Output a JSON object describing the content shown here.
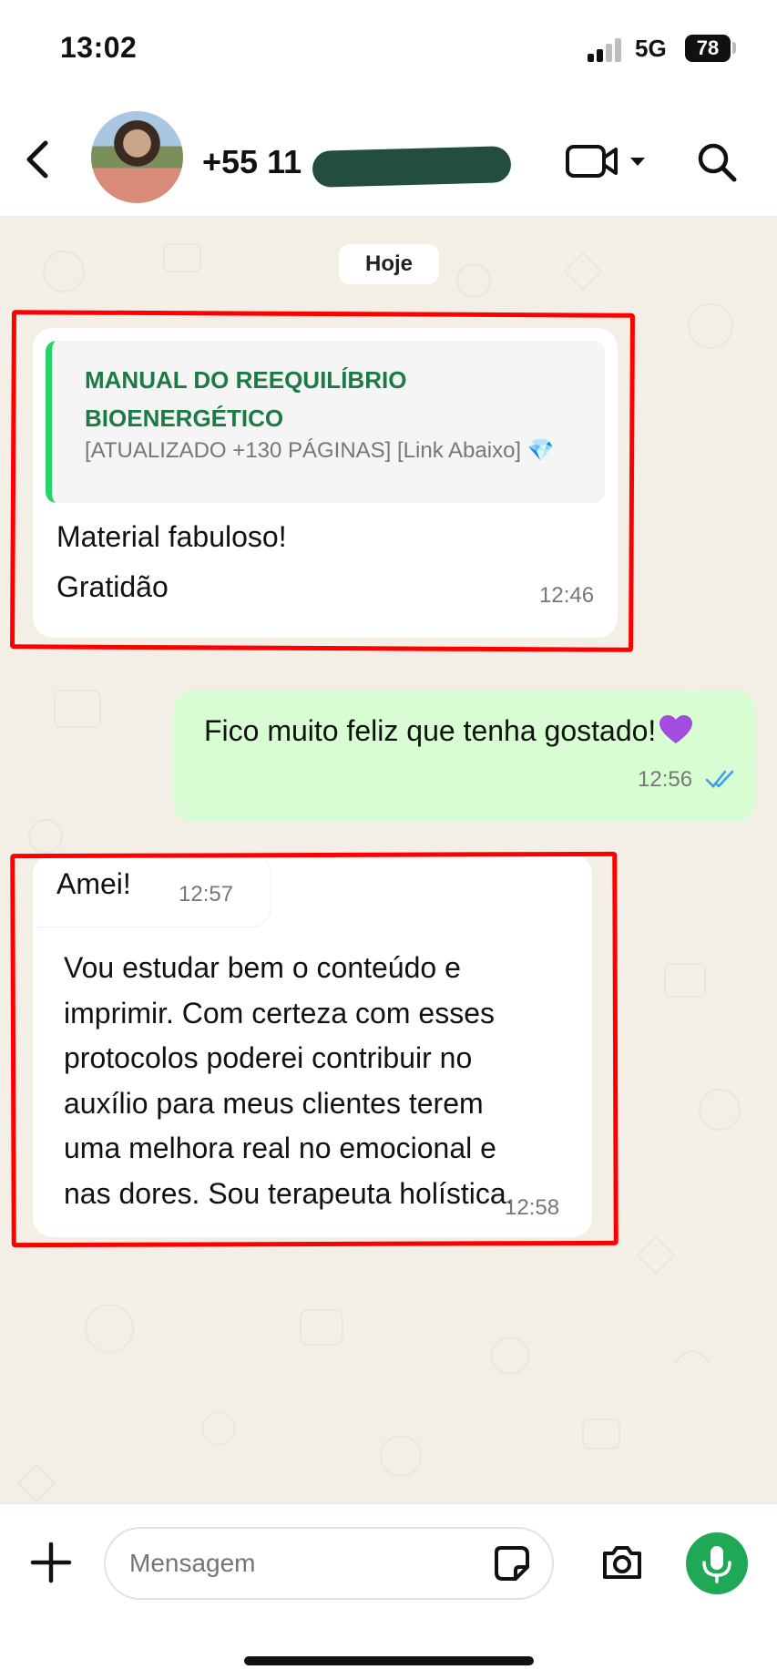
{
  "status_bar": {
    "time": "13:02",
    "network": "5G",
    "battery": "78"
  },
  "header": {
    "contact_name": "+55 11",
    "back_icon": "chevron-left-icon",
    "video_icon": "video-camera-icon",
    "dropdown_icon": "caret-down-icon",
    "search_icon": "search-icon"
  },
  "chat": {
    "date_label": "Hoje",
    "messages": [
      {
        "direction": "in",
        "quote_title": "MANUAL DO REEQUILÍBRIO BIOENERGÉTICO",
        "quote_subtitle": "[ATUALIZADO +130 PÁGINAS] [Link Abaixo]",
        "quote_emoji": "💎",
        "line1": "Material fabuloso!",
        "line2": "Gratidão",
        "time": "12:46"
      },
      {
        "direction": "out",
        "text": "Fico muito feliz que tenha gostado!",
        "emoji": "purple-heart",
        "time": "12:56",
        "status": "read"
      },
      {
        "direction": "in",
        "text": "Amei!",
        "time": "12:57"
      },
      {
        "direction": "in",
        "lines": [
          "Vou estudar bem o conteúdo e",
          "imprimir. Com certeza com esses",
          "protocolos poderei contribuir no",
          "auxílio para meus clientes terem",
          "uma melhora real no emocional e",
          "nas dores. Sou terapeuta holística."
        ],
        "time": "12:58"
      }
    ]
  },
  "input_bar": {
    "placeholder": "Mensagem",
    "plus_icon": "plus-icon",
    "sticker_icon": "sticker-icon",
    "camera_icon": "camera-icon",
    "mic_icon": "microphone-icon"
  },
  "colors": {
    "accent_green": "#1fa855",
    "outgoing_bubble": "#d9fdd3",
    "quote_bar": "#25d366",
    "annotation_red": "#ff0000",
    "read_ticks": "#3b9df0"
  }
}
